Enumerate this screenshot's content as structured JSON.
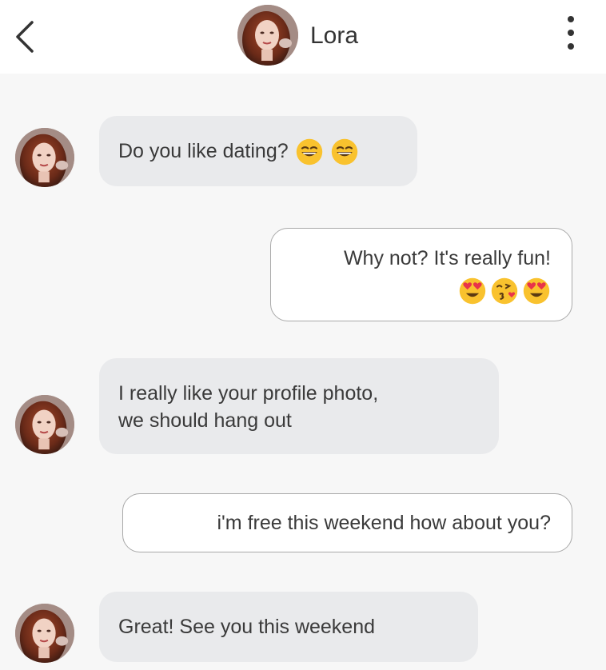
{
  "contact": {
    "name": "Lora"
  },
  "messages": [
    {
      "direction": "incoming",
      "text": "Do you like dating?",
      "emojis": [
        "grin-emoji",
        "grin-emoji"
      ]
    },
    {
      "direction": "outgoing",
      "text": "Why not? It's really fun!",
      "emojis": [
        "heart-eyes-emoji",
        "kiss-emoji",
        "heart-eyes-emoji"
      ]
    },
    {
      "direction": "incoming",
      "line1": "I really like your profile photo,",
      "line2": "we should hang out"
    },
    {
      "direction": "outgoing",
      "text": "i'm free this weekend how about you?"
    },
    {
      "direction": "incoming",
      "text": "Great! See you this weekend"
    }
  ],
  "colors": {
    "background": "#f7f7f7",
    "header": "#ffffff",
    "incoming_bubble": "#e9eaec",
    "outgoing_border": "#a9a9a9",
    "emoji_yellow": "#f9c22e",
    "heart_red": "#e8344a"
  },
  "icons": {
    "back": "chevron-left-icon",
    "menu": "more-vertical-icon"
  }
}
